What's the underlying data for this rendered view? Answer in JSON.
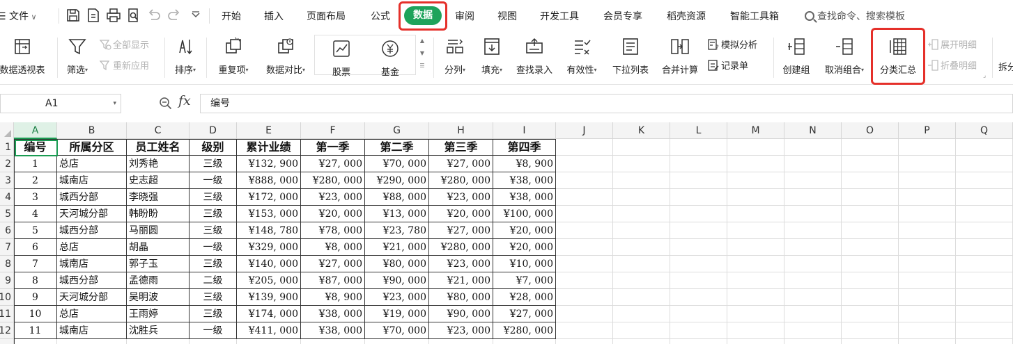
{
  "menubar": {
    "file_label": "文件",
    "tabs": [
      "开始",
      "插入",
      "页面布局",
      "公式",
      "数据",
      "审阅",
      "视图",
      "开发工具",
      "会员专享",
      "稻壳资源",
      "智能工具箱"
    ],
    "active_tab": "数据",
    "search_placeholder": "查找命令、搜索模板"
  },
  "ribbon": {
    "pivot_table": "数据透视表",
    "filter": "筛选",
    "show_all": "全部显示",
    "reapply": "重新应用",
    "sort": "排序",
    "duplicates": "重复项",
    "compare": "数据对比",
    "stocks": "股票",
    "funds": "基金",
    "split_column": "分列",
    "fill": "填充",
    "lookup_entry": "查找录入",
    "validity": "有效性",
    "dropdown_list": "下拉列表",
    "consolidate": "合并计算",
    "what_if": "模拟分析",
    "record_form": "记录单",
    "create_group": "创建组",
    "ungroup": "取消组合",
    "subtotal": "分类汇总",
    "expand_detail": "展开明细",
    "collapse_detail": "折叠明细",
    "split_more": "拆分"
  },
  "formula_bar": {
    "name_box": "A1",
    "fx": "fx",
    "content": "编号"
  },
  "sheet": {
    "columns": [
      "A",
      "B",
      "C",
      "D",
      "E",
      "F",
      "G",
      "H",
      "I",
      "J",
      "K",
      "L",
      "M",
      "N",
      "O",
      "P",
      "Q"
    ],
    "row_numbers": [
      "1",
      "2",
      "3",
      "4",
      "5",
      "6",
      "7",
      "8",
      "9",
      "10",
      "11",
      "12"
    ],
    "headers": [
      "编号",
      "所属分区",
      "员工姓名",
      "级别",
      "累计业绩",
      "第一季",
      "第二季",
      "第三季",
      "第四季"
    ],
    "rows": [
      [
        "1",
        "总店",
        "刘秀艳",
        "三级",
        "¥132, 900",
        "¥27, 000",
        "¥70, 000",
        "¥27, 000",
        "¥8, 900"
      ],
      [
        "2",
        "城南店",
        "史志超",
        "一级",
        "¥888, 000",
        "¥280, 000",
        "¥290, 000",
        "¥280, 000",
        "¥38, 000"
      ],
      [
        "3",
        "城西分部",
        "李晓强",
        "三级",
        "¥172, 000",
        "¥23, 000",
        "¥88, 000",
        "¥23, 000",
        "¥38, 000"
      ],
      [
        "4",
        "天河城分部",
        "韩盼盼",
        "三级",
        "¥153, 000",
        "¥20, 000",
        "¥13, 000",
        "¥20, 000",
        "¥100, 000"
      ],
      [
        "5",
        "城西分部",
        "马丽圆",
        "三级",
        "¥148, 780",
        "¥78, 000",
        "¥23, 780",
        "¥27, 000",
        "¥20, 000"
      ],
      [
        "6",
        "总店",
        "胡晶",
        "一级",
        "¥329, 000",
        "¥8, 000",
        "¥21, 000",
        "¥280, 000",
        "¥20, 000"
      ],
      [
        "7",
        "城南店",
        "郭子玉",
        "三级",
        "¥140, 000",
        "¥27, 000",
        "¥80, 000",
        "¥23, 000",
        "¥10, 000"
      ],
      [
        "8",
        "城西分部",
        "孟德雨",
        "二级",
        "¥205, 000",
        "¥87, 000",
        "¥90, 000",
        "¥21, 000",
        "¥7, 000"
      ],
      [
        "9",
        "天河城分部",
        "吴明波",
        "三级",
        "¥139, 900",
        "¥8, 900",
        "¥23, 000",
        "¥80, 000",
        "¥28, 000"
      ],
      [
        "10",
        "总店",
        "王雨婷",
        "三级",
        "¥174, 000",
        "¥38, 000",
        "¥19, 000",
        "¥90, 000",
        "¥27, 000"
      ],
      [
        "11",
        "城南店",
        "沈胜兵",
        "一级",
        "¥411, 000",
        "¥38, 000",
        "¥70, 000",
        "¥23, 000",
        "¥280, 000"
      ]
    ]
  },
  "colors": {
    "accent_green": "#1ea35b",
    "highlight_red": "#e5302a"
  }
}
